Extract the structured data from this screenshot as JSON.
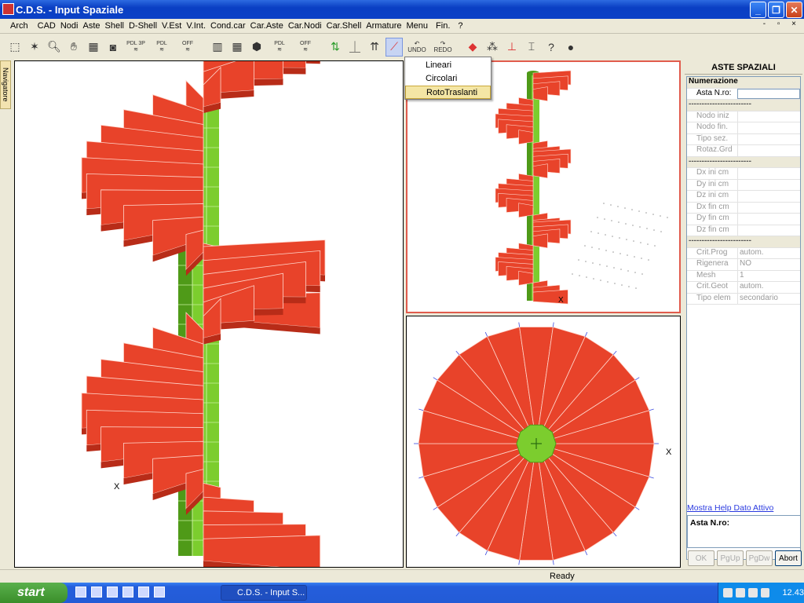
{
  "window": {
    "title": "C.D.S. - Input Spaziale"
  },
  "menu": [
    "Arch",
    "CAD",
    "Nodi",
    "Aste",
    "Shell",
    "D-Shell",
    "V.Est",
    "V.Int.",
    "Cond.car",
    "Car.Aste",
    "Car.Nodi",
    "Car.Shell",
    "Armature",
    "Menu",
    "Fin.",
    "?"
  ],
  "toolbar": {
    "pdl_3p": "PDL 3P",
    "pdl": "PDL",
    "off": "OFF",
    "undo": "UNDO",
    "redo": "REDO"
  },
  "navigator": {
    "label": "Navigatore"
  },
  "dropdown": {
    "items": [
      "Lineari",
      "Circolari",
      "RotoTraslanti"
    ],
    "selected": 2
  },
  "panel": {
    "title": "ASTE SPAZIALI",
    "section_numerazione": "Numerazione",
    "asta_label": "Asta N.ro:",
    "asta_value": "",
    "group1": [
      {
        "label": "Nodo iniz",
        "value": ""
      },
      {
        "label": "Nodo fin.",
        "value": ""
      },
      {
        "label": "Tipo sez.",
        "value": ""
      },
      {
        "label": "Rotaz.Grd",
        "value": ""
      }
    ],
    "group2": [
      {
        "label": "Dx ini cm",
        "value": ""
      },
      {
        "label": "Dy ini cm",
        "value": ""
      },
      {
        "label": "Dz ini cm",
        "value": ""
      },
      {
        "label": "Dx fin cm",
        "value": ""
      },
      {
        "label": "Dy fin cm",
        "value": ""
      },
      {
        "label": "Dz fin cm",
        "value": ""
      }
    ],
    "group3": [
      {
        "label": "Crit.Prog",
        "value": "autom."
      },
      {
        "label": "Rigenera",
        "value": "NO"
      },
      {
        "label": "Mesh",
        "value": "1"
      },
      {
        "label": "Crit.Geot",
        "value": "autom."
      },
      {
        "label": "Tipo elem",
        "value": "secondario"
      }
    ],
    "separator": "------------------------",
    "help_link": "Mostra Help Dato Attivo",
    "help_text": "Asta N.ro:",
    "buttons": {
      "ok": "OK",
      "pgup": "PgUp",
      "pgdw": "PgDw",
      "abort": "Abort"
    }
  },
  "status": {
    "text": "Ready"
  },
  "taskbar": {
    "start": "start",
    "task": "C.D.S. - Input S...",
    "clock": "12.43"
  },
  "axis": {
    "x": "X"
  },
  "colors": {
    "stair": "#e8432a",
    "stair_dark": "#b82c18",
    "column": "#7ccd2e",
    "column_dark": "#4f9a18",
    "selection": "#e15c4d"
  }
}
